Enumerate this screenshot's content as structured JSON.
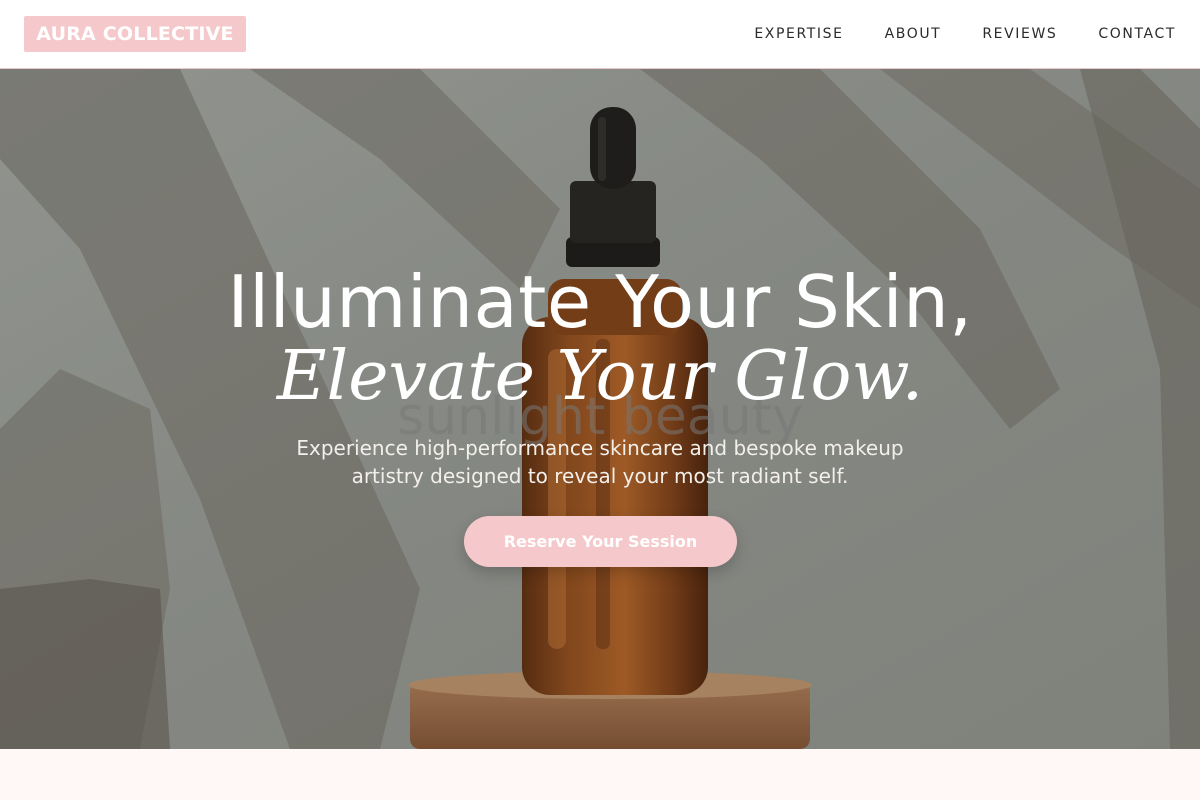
{
  "brand": {
    "logo_text": "AURA COLLECTIVE",
    "accent_color": "#f5c9cb"
  },
  "nav": {
    "items": [
      {
        "label": "EXPERTISE"
      },
      {
        "label": "ABOUT"
      },
      {
        "label": "REVIEWS"
      },
      {
        "label": "CONTACT"
      }
    ]
  },
  "hero": {
    "headline_line1": "Illuminate Your Skin,",
    "headline_line2": "Elevate Your Glow.",
    "watermark_text": "sunlight beauty",
    "subtitle": "Experience high-performance skincare and bespoke makeup artistry designed to reveal your most radiant self.",
    "cta_label": "Reserve Your Session",
    "image_subject": "amber dropper bottle on wooden stand with leaf shadows"
  }
}
